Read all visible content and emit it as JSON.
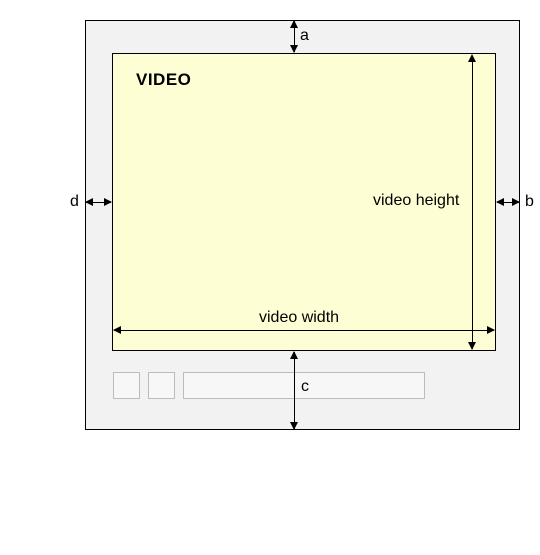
{
  "video_label": "VIDEO",
  "dim_width_label": "video width",
  "dim_height_label": "video height",
  "margin_top_label": "a",
  "margin_right_label": "b",
  "margin_bottom_label": "c",
  "margin_left_label": "d"
}
